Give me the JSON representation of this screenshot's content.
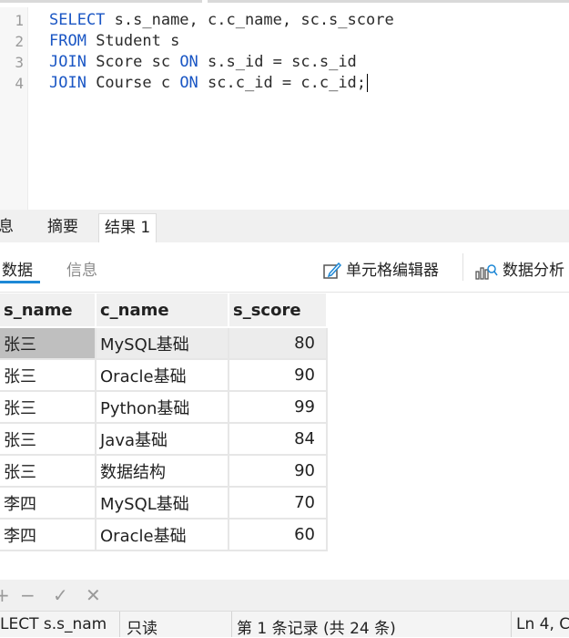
{
  "editor": {
    "line_numbers": [
      "1",
      "2",
      "3",
      "4"
    ],
    "lines": [
      {
        "kw1": "SELECT",
        "rest1": " s.s_name, c.c_name, sc.s_score",
        "kw2": "",
        "rest2": ""
      },
      {
        "kw1": "FROM",
        "rest1": " Student s",
        "kw2": "",
        "rest2": ""
      },
      {
        "kw1": "JOIN",
        "rest1": " Score sc ",
        "kw2": "ON",
        "rest2": " s.s_id = sc.s_id"
      },
      {
        "kw1": "JOIN",
        "rest1": " Course c ",
        "kw2": "ON",
        "rest2": " sc.c_id = c.c_id;"
      }
    ]
  },
  "tabs": [
    "息",
    "摘要",
    "结果 1"
  ],
  "subtabs": {
    "data": "数据",
    "info": "信息"
  },
  "toolbar": {
    "cell_editor": "单元格编辑器",
    "data_analysis": "数据分析"
  },
  "table": {
    "columns": [
      "s_name",
      "c_name",
      "s_score"
    ],
    "rows": [
      [
        "张三",
        "MySQL基础",
        "80"
      ],
      [
        "张三",
        "Oracle基础",
        "90"
      ],
      [
        "张三",
        "Python基础",
        "99"
      ],
      [
        "张三",
        "Java基础",
        "84"
      ],
      [
        "张三",
        "数据结构",
        "90"
      ],
      [
        "李四",
        "MySQL基础",
        "70"
      ],
      [
        "李四",
        "Oracle基础",
        "60"
      ]
    ]
  },
  "bottom_tools": {
    "add": "+",
    "remove": "−",
    "apply": "✓",
    "cancel": "✕"
  },
  "status": {
    "query": "LECT s.s_nam",
    "readonly": "只读",
    "record": "第 1 条记录 (共 24 条)",
    "position": "Ln 4, C"
  },
  "colors": {
    "keyword": "#1a56c4",
    "accent": "#1e88d6"
  }
}
